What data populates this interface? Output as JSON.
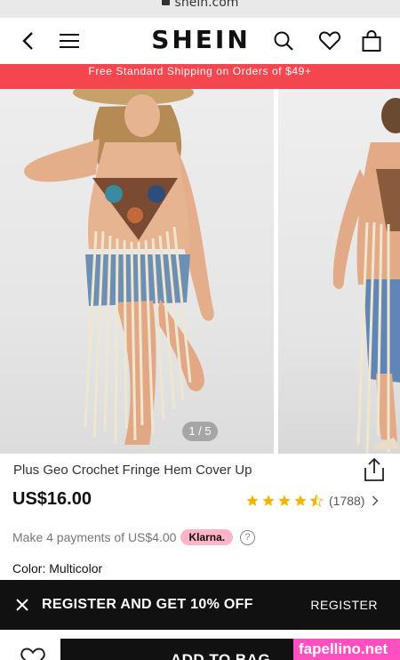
{
  "browser": {
    "url": "shein.com"
  },
  "header": {
    "logo": "SHEIN",
    "icons": [
      "back-icon",
      "menu-icon",
      "search-icon",
      "heart-icon",
      "bag-icon"
    ]
  },
  "promo": {
    "text": "Free Standard Shipping on Orders of $49+",
    "color": "#f4464e"
  },
  "gallery": {
    "counter": "1 / 5"
  },
  "product": {
    "title": "Plus Geo Crochet Fringe Hem Cover Up",
    "price": "US$16.00",
    "rating": {
      "stars": 4.5,
      "count": "(1788)"
    },
    "installments": {
      "text": "Make 4 payments of US$4.00",
      "provider": "Klarna."
    },
    "color": "Color: Multicolor"
  },
  "register_banner": {
    "message": "REGISTER AND GET 10% OFF",
    "link": "REGISTER"
  },
  "bottom": {
    "add_to_bag": "ADD TO BAG"
  },
  "watermark": "fapellino.net",
  "colors": {
    "accent": "#f4464e",
    "star": "#f6b400",
    "klarna": "#ffb3c7",
    "dark": "#111111"
  }
}
